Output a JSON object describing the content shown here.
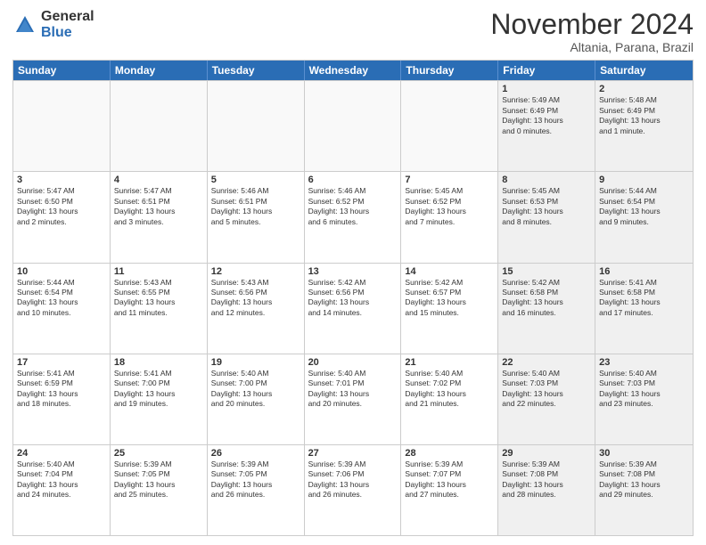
{
  "logo": {
    "general": "General",
    "blue": "Blue"
  },
  "title": "November 2024",
  "subtitle": "Altania, Parana, Brazil",
  "days": [
    "Sunday",
    "Monday",
    "Tuesday",
    "Wednesday",
    "Thursday",
    "Friday",
    "Saturday"
  ],
  "rows": [
    [
      {
        "day": "",
        "text": "",
        "empty": true
      },
      {
        "day": "",
        "text": "",
        "empty": true
      },
      {
        "day": "",
        "text": "",
        "empty": true
      },
      {
        "day": "",
        "text": "",
        "empty": true
      },
      {
        "day": "",
        "text": "",
        "empty": true
      },
      {
        "day": "1",
        "text": "Sunrise: 5:49 AM\nSunset: 6:49 PM\nDaylight: 13 hours\nand 0 minutes.",
        "shaded": true
      },
      {
        "day": "2",
        "text": "Sunrise: 5:48 AM\nSunset: 6:49 PM\nDaylight: 13 hours\nand 1 minute.",
        "shaded": true
      }
    ],
    [
      {
        "day": "3",
        "text": "Sunrise: 5:47 AM\nSunset: 6:50 PM\nDaylight: 13 hours\nand 2 minutes."
      },
      {
        "day": "4",
        "text": "Sunrise: 5:47 AM\nSunset: 6:51 PM\nDaylight: 13 hours\nand 3 minutes."
      },
      {
        "day": "5",
        "text": "Sunrise: 5:46 AM\nSunset: 6:51 PM\nDaylight: 13 hours\nand 5 minutes."
      },
      {
        "day": "6",
        "text": "Sunrise: 5:46 AM\nSunset: 6:52 PM\nDaylight: 13 hours\nand 6 minutes."
      },
      {
        "day": "7",
        "text": "Sunrise: 5:45 AM\nSunset: 6:52 PM\nDaylight: 13 hours\nand 7 minutes."
      },
      {
        "day": "8",
        "text": "Sunrise: 5:45 AM\nSunset: 6:53 PM\nDaylight: 13 hours\nand 8 minutes.",
        "shaded": true
      },
      {
        "day": "9",
        "text": "Sunrise: 5:44 AM\nSunset: 6:54 PM\nDaylight: 13 hours\nand 9 minutes.",
        "shaded": true
      }
    ],
    [
      {
        "day": "10",
        "text": "Sunrise: 5:44 AM\nSunset: 6:54 PM\nDaylight: 13 hours\nand 10 minutes."
      },
      {
        "day": "11",
        "text": "Sunrise: 5:43 AM\nSunset: 6:55 PM\nDaylight: 13 hours\nand 11 minutes."
      },
      {
        "day": "12",
        "text": "Sunrise: 5:43 AM\nSunset: 6:56 PM\nDaylight: 13 hours\nand 12 minutes."
      },
      {
        "day": "13",
        "text": "Sunrise: 5:42 AM\nSunset: 6:56 PM\nDaylight: 13 hours\nand 14 minutes."
      },
      {
        "day": "14",
        "text": "Sunrise: 5:42 AM\nSunset: 6:57 PM\nDaylight: 13 hours\nand 15 minutes."
      },
      {
        "day": "15",
        "text": "Sunrise: 5:42 AM\nSunset: 6:58 PM\nDaylight: 13 hours\nand 16 minutes.",
        "shaded": true
      },
      {
        "day": "16",
        "text": "Sunrise: 5:41 AM\nSunset: 6:58 PM\nDaylight: 13 hours\nand 17 minutes.",
        "shaded": true
      }
    ],
    [
      {
        "day": "17",
        "text": "Sunrise: 5:41 AM\nSunset: 6:59 PM\nDaylight: 13 hours\nand 18 minutes."
      },
      {
        "day": "18",
        "text": "Sunrise: 5:41 AM\nSunset: 7:00 PM\nDaylight: 13 hours\nand 19 minutes."
      },
      {
        "day": "19",
        "text": "Sunrise: 5:40 AM\nSunset: 7:00 PM\nDaylight: 13 hours\nand 20 minutes."
      },
      {
        "day": "20",
        "text": "Sunrise: 5:40 AM\nSunset: 7:01 PM\nDaylight: 13 hours\nand 20 minutes."
      },
      {
        "day": "21",
        "text": "Sunrise: 5:40 AM\nSunset: 7:02 PM\nDaylight: 13 hours\nand 21 minutes."
      },
      {
        "day": "22",
        "text": "Sunrise: 5:40 AM\nSunset: 7:03 PM\nDaylight: 13 hours\nand 22 minutes.",
        "shaded": true
      },
      {
        "day": "23",
        "text": "Sunrise: 5:40 AM\nSunset: 7:03 PM\nDaylight: 13 hours\nand 23 minutes.",
        "shaded": true
      }
    ],
    [
      {
        "day": "24",
        "text": "Sunrise: 5:40 AM\nSunset: 7:04 PM\nDaylight: 13 hours\nand 24 minutes."
      },
      {
        "day": "25",
        "text": "Sunrise: 5:39 AM\nSunset: 7:05 PM\nDaylight: 13 hours\nand 25 minutes."
      },
      {
        "day": "26",
        "text": "Sunrise: 5:39 AM\nSunset: 7:05 PM\nDaylight: 13 hours\nand 26 minutes."
      },
      {
        "day": "27",
        "text": "Sunrise: 5:39 AM\nSunset: 7:06 PM\nDaylight: 13 hours\nand 26 minutes."
      },
      {
        "day": "28",
        "text": "Sunrise: 5:39 AM\nSunset: 7:07 PM\nDaylight: 13 hours\nand 27 minutes."
      },
      {
        "day": "29",
        "text": "Sunrise: 5:39 AM\nSunset: 7:08 PM\nDaylight: 13 hours\nand 28 minutes.",
        "shaded": true
      },
      {
        "day": "30",
        "text": "Sunrise: 5:39 AM\nSunset: 7:08 PM\nDaylight: 13 hours\nand 29 minutes.",
        "shaded": true
      }
    ]
  ]
}
